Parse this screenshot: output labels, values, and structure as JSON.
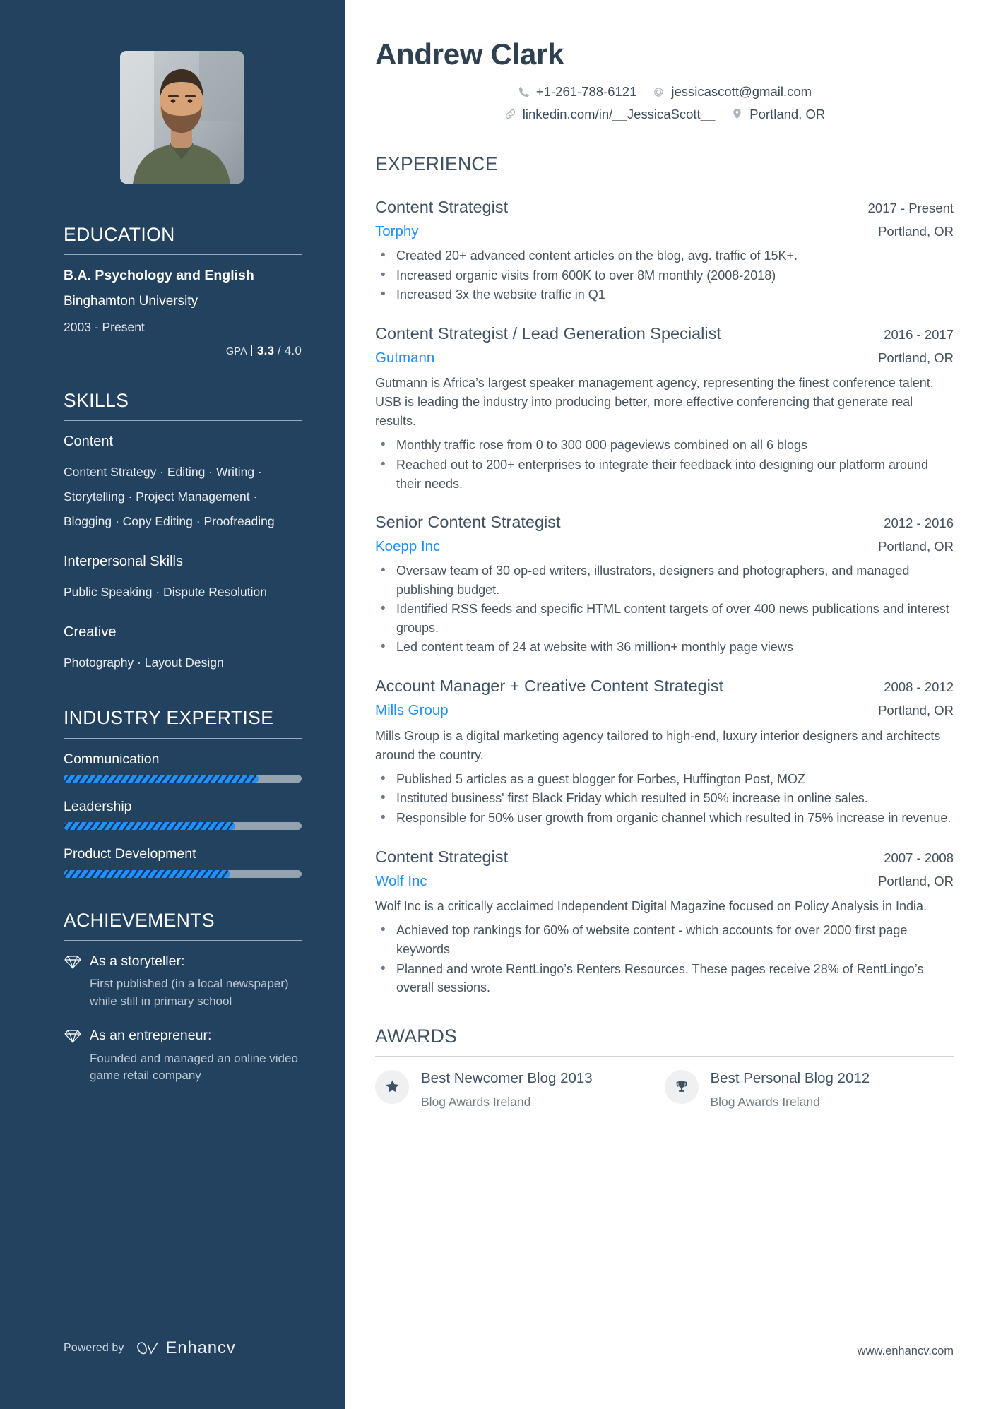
{
  "colors": {
    "sidebar_bg": "#23425f",
    "accent_blue": "#1e90ff",
    "heading": "#3f5264",
    "body_text": "#46545f"
  },
  "header": {
    "name": "Andrew Clark",
    "contact": {
      "phone": "+1-261-788-6121",
      "email": "jessicascott@gmail.com",
      "linkedin": "linkedin.com/in/__JessicaScott__",
      "location": "Portland, OR"
    },
    "icons": {
      "phone": "phone-icon",
      "email": "at-sign-icon",
      "linkedin": "link-icon",
      "location": "map-pin-icon"
    }
  },
  "sidebar": {
    "photo_alt": "profile-photo",
    "education": {
      "heading": "EDUCATION",
      "degree": "B.A. Psychology and English",
      "school": "Binghamton University",
      "dates": "2003 - Present",
      "gpa_label": "GPA",
      "gpa_value": "3.3",
      "gpa_max": "/ 4.0"
    },
    "skills": {
      "heading": "SKILLS",
      "groups": [
        {
          "title": "Content",
          "items": "Content Strategy · Editing · Writing · Storytelling · Project Management · Blogging · Copy Editing · Proofreading"
        },
        {
          "title": "Interpersonal Skills",
          "items": "Public Speaking · Dispute Resolution"
        },
        {
          "title": "Creative",
          "items": "Photography · Layout Design"
        }
      ]
    },
    "expertise": {
      "heading": "INDUSTRY EXPERTISE",
      "items": [
        {
          "label": "Communication",
          "percent": 82
        },
        {
          "label": "Leadership",
          "percent": 72
        },
        {
          "label": "Product Development",
          "percent": 70
        }
      ]
    },
    "achievements": {
      "heading": "ACHIEVEMENTS",
      "items": [
        {
          "icon": "diamond-icon",
          "title": "As a storyteller:",
          "description": "First published (in a local newspaper) while still in primary school"
        },
        {
          "icon": "diamond-icon",
          "title": "As an entrepreneur:",
          "description": "Founded and managed an online video game retail company"
        }
      ]
    },
    "footer": {
      "powered_by": "Powered by",
      "brand": "Enhancv",
      "brand_icon": "enhancv-logo-icon"
    }
  },
  "main": {
    "experience": {
      "heading": "EXPERIENCE",
      "jobs": [
        {
          "title": "Content Strategist",
          "dates": "2017 - Present",
          "company": "Torphy",
          "location": "Portland, OR",
          "summary": "",
          "bullets": [
            "Created 20+ advanced content articles on the blog, avg. traffic of 15K+.",
            "Increased organic visits from 600K to over 8M monthly (2008-2018)",
            "Increased 3x the website traffic in Q1"
          ]
        },
        {
          "title": "Content Strategist / Lead Generation Specialist",
          "dates": "2016 - 2017",
          "company": "Gutmann",
          "location": "Portland, OR",
          "summary": "Gutmann is Africa’s largest speaker management agency, representing the finest conference talent. USB is leading the industry into producing better, more effective conferencing that generate real results.",
          "bullets": [
            "Monthly traffic rose from 0 to 300 000 pageviews combined on all 6 blogs",
            "Reached out to 200+ enterprises to integrate their feedback into designing our platform around their needs."
          ]
        },
        {
          "title": "Senior Content Strategist",
          "dates": "2012 - 2016",
          "company": "Koepp Inc",
          "location": "Portland, OR",
          "summary": "",
          "bullets": [
            "Oversaw team of 30 op-ed writers, illustrators, designers and photographers, and managed publishing budget.",
            "Identified RSS feeds and specific HTML content targets of over 400 news publications and interest groups.",
            "Led content team of 24 at website with 36 million+ monthly page views"
          ]
        },
        {
          "title": "Account Manager + Creative Content Strategist",
          "dates": "2008 - 2012",
          "company": "Mills Group",
          "location": "Portland, OR",
          "summary": "Mills Group is a digital marketing agency tailored to high-end, luxury interior designers and architects around the country.",
          "bullets": [
            "Published 5 articles as a guest blogger for Forbes, Huffington Post, MOZ",
            "Instituted business' first Black Friday which resulted in 50% increase in online sales.",
            "Responsible for 50% user growth from organic channel which resulted in 75% increase in revenue."
          ]
        },
        {
          "title": "Content Strategist",
          "dates": "2007 - 2008",
          "company": "Wolf Inc",
          "location": "Portland, OR",
          "summary": "Wolf Inc is a critically acclaimed Independent Digital Magazine focused on Policy Analysis in India.",
          "bullets": [
            "Achieved top rankings for 60% of website content - which accounts for over 2000 first page keywords",
            "Planned and wrote RentLingo’s Renters Resources. These pages receive 28% of RentLingo’s overall sessions."
          ]
        }
      ]
    },
    "awards": {
      "heading": "AWARDS",
      "items": [
        {
          "icon": "star-icon",
          "title": "Best Newcomer Blog 2013",
          "organization": "Blog Awards Ireland"
        },
        {
          "icon": "trophy-icon",
          "title": "Best Personal Blog 2012",
          "organization": "Blog Awards Ireland"
        }
      ]
    },
    "footer_url": "www.enhancv.com"
  }
}
